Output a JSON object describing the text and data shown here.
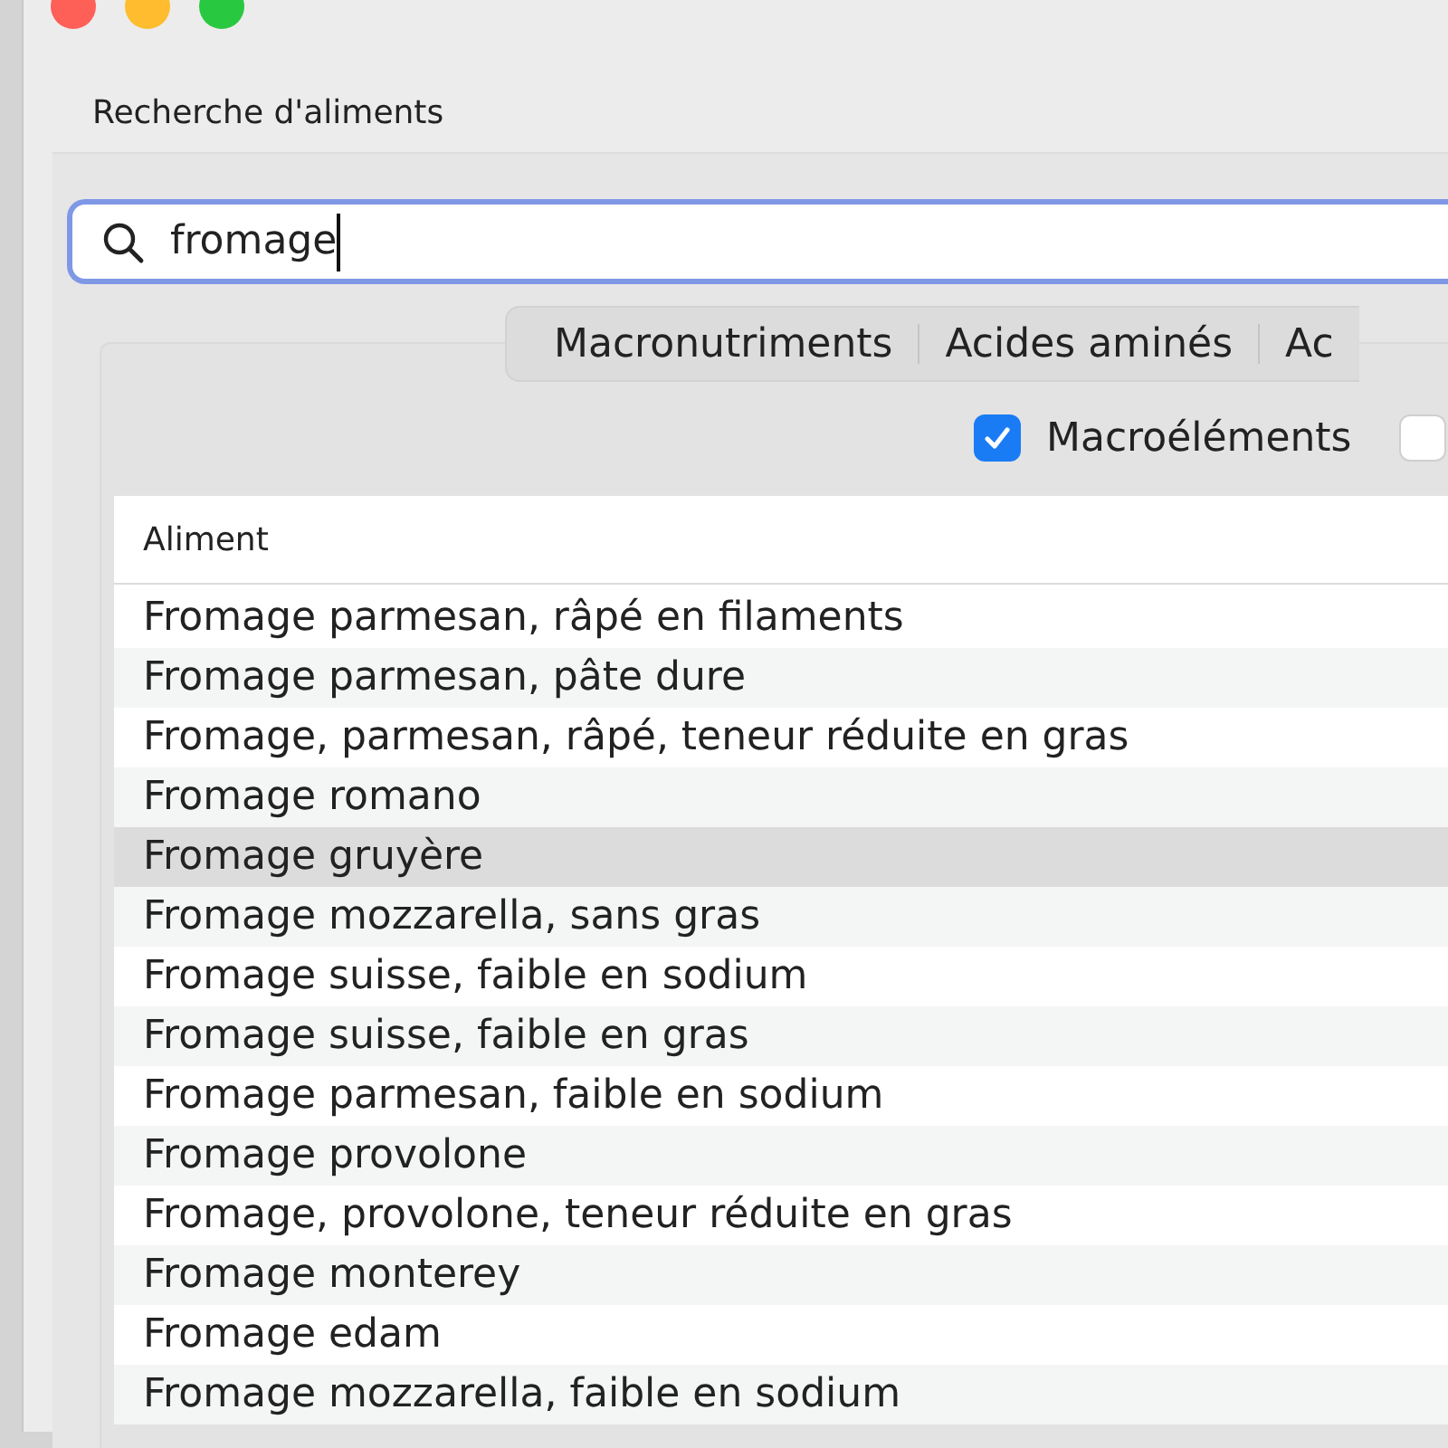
{
  "window": {
    "title": "Recherche d'aliments"
  },
  "search": {
    "value": "fromage"
  },
  "tabs": [
    {
      "label": "Macronutriments"
    },
    {
      "label": "Acides aminés"
    },
    {
      "label": "Ac"
    }
  ],
  "filters": [
    {
      "label": "Macroéléments",
      "checked": true
    },
    {
      "checked": false
    }
  ],
  "table": {
    "columns": [
      "Aliment"
    ],
    "rows": [
      {
        "cells": [
          "Fromage parmesan, râpé en filaments"
        ],
        "selected": false
      },
      {
        "cells": [
          "Fromage parmesan, pâte dure"
        ],
        "selected": false
      },
      {
        "cells": [
          "Fromage, parmesan, râpé, teneur réduite en gras"
        ],
        "selected": false
      },
      {
        "cells": [
          "Fromage romano"
        ],
        "selected": false
      },
      {
        "cells": [
          "Fromage gruyère"
        ],
        "selected": true
      },
      {
        "cells": [
          "Fromage mozzarella, sans gras"
        ],
        "selected": false
      },
      {
        "cells": [
          "Fromage suisse, faible en sodium"
        ],
        "selected": false
      },
      {
        "cells": [
          "Fromage suisse, faible en gras"
        ],
        "selected": false
      },
      {
        "cells": [
          "Fromage parmesan, faible en sodium"
        ],
        "selected": false
      },
      {
        "cells": [
          "Fromage provolone"
        ],
        "selected": false
      },
      {
        "cells": [
          "Fromage, provolone, teneur réduite en gras"
        ],
        "selected": false
      },
      {
        "cells": [
          "Fromage monterey"
        ],
        "selected": false
      },
      {
        "cells": [
          "Fromage edam"
        ],
        "selected": false
      },
      {
        "cells": [
          "Fromage mozzarella, faible en sodium"
        ],
        "selected": false
      }
    ]
  }
}
